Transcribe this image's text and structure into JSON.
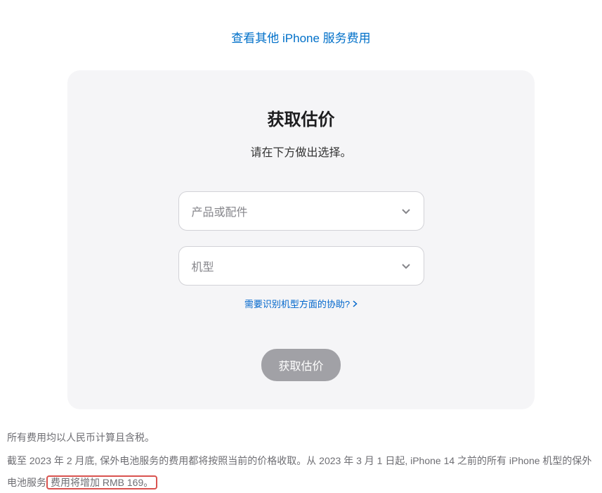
{
  "topLink": "查看其他 iPhone 服务费用",
  "card": {
    "title": "获取估价",
    "subtitle": "请在下方做出选择。",
    "productSelectPlaceholder": "产品或配件",
    "modelSelectPlaceholder": "机型",
    "helpLink": "需要识别机型方面的协助?",
    "buttonLabel": "获取估价"
  },
  "footer": {
    "line1": "所有费用均以人民币计算且含税。",
    "line2Part1": "截至 2023 年 2 月底, 保外电池服务的费用都将按照当前的价格收取。从 2023 年 3 月 1 日起, iPhone 14 之前的所有 iPhone 机型的保外电池服务",
    "line2Highlight": "费用将增加 RMB 169。"
  }
}
